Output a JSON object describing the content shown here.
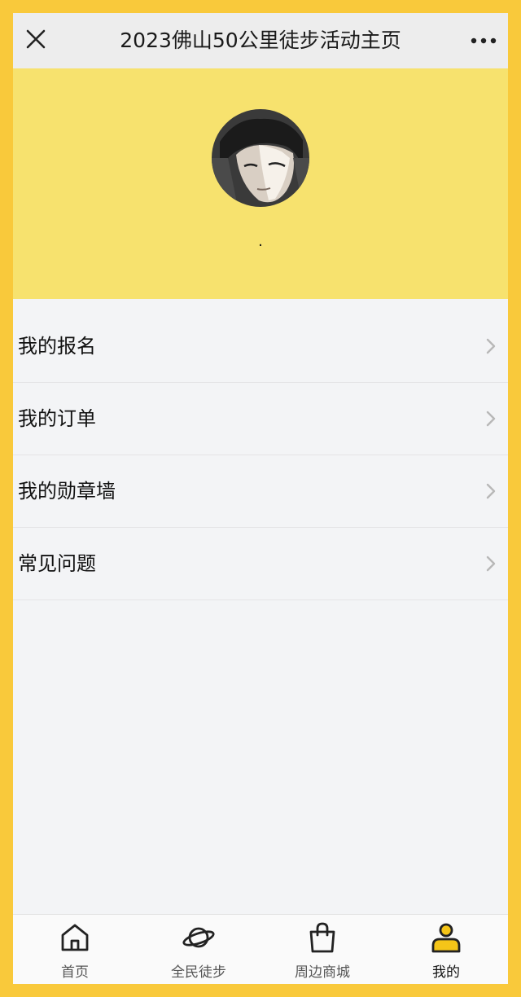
{
  "topbar": {
    "title": "2023佛山50公里徒步活动主页",
    "close_icon": "close-icon",
    "more_icon": "more-icon"
  },
  "profile": {
    "username": "·",
    "avatar": "avatar-image",
    "header_color": "#f7e26e"
  },
  "menu": {
    "items": [
      {
        "label": "我的报名",
        "icon": "chevron-right-icon"
      },
      {
        "label": "我的订单",
        "icon": "chevron-right-icon"
      },
      {
        "label": "我的勋章墙",
        "icon": "chevron-right-icon"
      },
      {
        "label": "常见问题",
        "icon": "chevron-right-icon"
      }
    ]
  },
  "tabbar": {
    "tabs": [
      {
        "label": "首页",
        "icon": "home-icon"
      },
      {
        "label": "全民徒步",
        "icon": "planet-icon"
      },
      {
        "label": "周边商城",
        "icon": "shopping-bag-icon"
      },
      {
        "label": "我的",
        "icon": "user-icon",
        "active": true
      }
    ],
    "accent_color": "#f5c518"
  },
  "colors": {
    "frame": "#f9c93b",
    "background": "#f3f4f6"
  }
}
